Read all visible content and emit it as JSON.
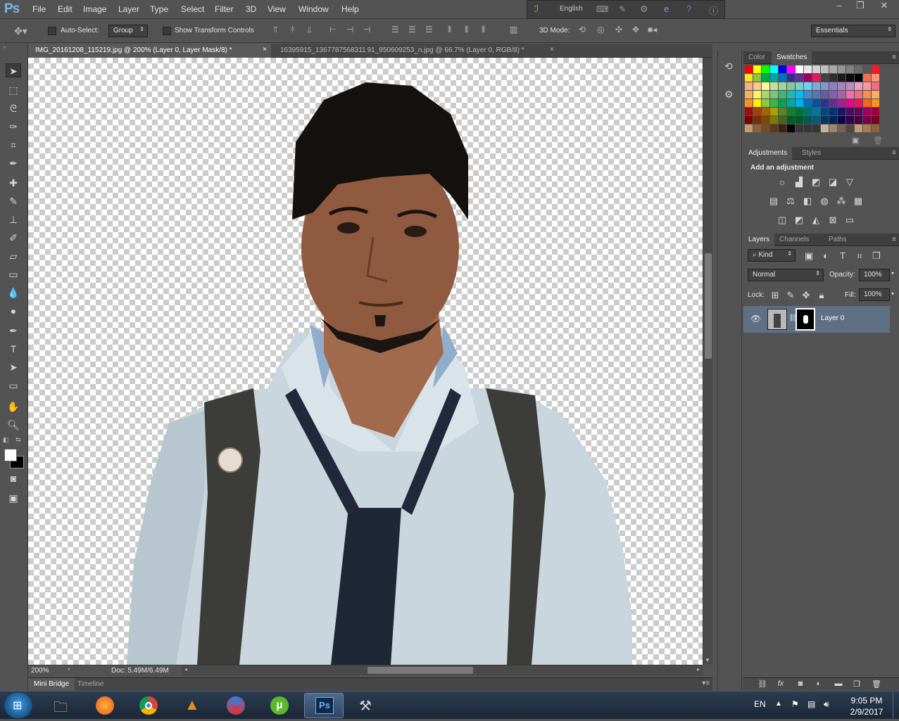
{
  "app": {
    "logo": "Ps"
  },
  "menu": [
    "File",
    "Edit",
    "Image",
    "Layer",
    "Type",
    "Select",
    "Filter",
    "3D",
    "View",
    "Window",
    "Help"
  ],
  "system_bar": {
    "language": "English"
  },
  "options_bar": {
    "auto_select_label": "Auto-Select:",
    "auto_select_value": "Group",
    "show_transform_label": "Show Transform Controls",
    "mode_3d_label": "3D Mode:",
    "workspace": "Essentials"
  },
  "doc_tabs": [
    {
      "label": "IMG_20161208_115219.jpg @ 200% (Layer 0, Layer Mask/8) *",
      "active": true
    },
    {
      "label": "16395915_1367787568311 91_950609253_n.jpg @ 66.7% (Layer 0, RGB/8) *",
      "active": false
    }
  ],
  "status": {
    "zoom": "200%",
    "doc": "Doc: 5.49M/6.49M"
  },
  "bottom_tabs": [
    "Mini Bridge",
    "Timeline"
  ],
  "color_panel": {
    "tabs": [
      "Color",
      "Swatches"
    ],
    "active": "Swatches"
  },
  "swatches": [
    [
      "#ff0000",
      "#ffff00",
      "#00ff00",
      "#00ffff",
      "#0000ff",
      "#ff00ff",
      "#ffffff",
      "#e6e6e6",
      "#d0d0d0",
      "#bdbdbd",
      "#a8a8a8",
      "#949494",
      "#808080",
      "#6b6b6b",
      "#575757",
      "#ee1c24"
    ],
    [
      "#f8e71c",
      "#8dc63f",
      "#00a651",
      "#00a99d",
      "#0072bc",
      "#2e3192",
      "#662d91",
      "#9e005d",
      "#ed145b",
      "#434343",
      "#2f2f2f",
      "#1c1c1c",
      "#0a0a0a",
      "#000000",
      "#f26c4f",
      "#f7977a"
    ],
    [
      "#f9ad81",
      "#fdc68a",
      "#fff799",
      "#c4df9b",
      "#a3d39c",
      "#82ca9d",
      "#7bcdc8",
      "#6ecff6",
      "#7ea7d8",
      "#8493ca",
      "#8882be",
      "#a187be",
      "#bc8dbf",
      "#f49ac2",
      "#f6989d",
      "#f26d7d"
    ],
    [
      "#fbaf5c",
      "#fff467",
      "#acd372",
      "#7cc576",
      "#3bb878",
      "#1abbb4",
      "#00bff3",
      "#438ccb",
      "#5574b9",
      "#605ca8",
      "#855fa8",
      "#a763a8",
      "#f06ea9",
      "#f26d7d",
      "#f68e55",
      "#fbaf5c"
    ],
    [
      "#f7941d",
      "#fff200",
      "#8dc73f",
      "#39b54a",
      "#00a650",
      "#00a99d",
      "#00aeef",
      "#0072bc",
      "#0054a6",
      "#2e3192",
      "#662d91",
      "#92278f",
      "#ec008c",
      "#ed145b",
      "#f26522",
      "#f7941d"
    ],
    [
      "#9e0b0f",
      "#a0410d",
      "#a36209",
      "#aba000",
      "#598527",
      "#197b30",
      "#007236",
      "#00746b",
      "#0076a3",
      "#004a80",
      "#003471",
      "#1b1464",
      "#440e62",
      "#630460",
      "#9e005d",
      "#9e0039"
    ],
    [
      "#790000",
      "#7b2e00",
      "#7d4900",
      "#827b00",
      "#406618",
      "#005e20",
      "#005826",
      "#005952",
      "#005b7f",
      "#003663",
      "#002157",
      "#0d004c",
      "#32004b",
      "#4b0049",
      "#7b0046",
      "#7a0026"
    ],
    [
      "#c69c6d",
      "#8c6239",
      "#754c24",
      "#603913",
      "#42210b",
      "#000000",
      "#363636",
      "#363636",
      "#363636",
      "#c7b299",
      "#998675",
      "#736357",
      "#534741",
      "#c69c6d",
      "#a67c52",
      "#8c6239"
    ]
  ],
  "adjustments_panel": {
    "tabs": [
      "Adjustments",
      "Styles"
    ],
    "heading": "Add an adjustment"
  },
  "layers_panel": {
    "tabs": [
      "Layers",
      "Channels",
      "Paths"
    ],
    "kind_label": "Kind",
    "blend_mode": "Normal",
    "opacity_label": "Opacity:",
    "opacity_value": "100%",
    "lock_label": "Lock:",
    "fill_label": "Fill:",
    "fill_value": "100%",
    "layers": [
      {
        "name": "Layer 0"
      }
    ]
  },
  "taskbar": {
    "language": "EN",
    "time": "9:05 PM",
    "date": "2/9/2017"
  }
}
